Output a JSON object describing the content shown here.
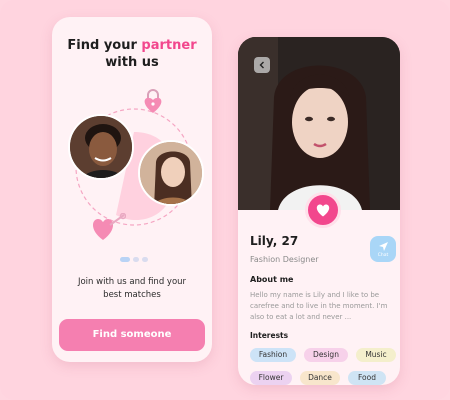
{
  "onboarding": {
    "title_line1_prefix": "Find your ",
    "title_accent": "partner",
    "title_line2": "with us",
    "subtitle": "Join with us and find your best matches",
    "cta_label": "Find someone"
  },
  "profile": {
    "name": "Lily, 27",
    "job": "Fashion Designer",
    "chat_label": "Chat",
    "about_title": "About me",
    "about_text": "Hello my name is Lily and I like to be carefree and to live in the moment. I'm also to eat a lot and never ...",
    "interests_title": "Interests",
    "interests": [
      {
        "label": "Fashion",
        "color": "#cde3f7"
      },
      {
        "label": "Design",
        "color": "#f7d1ea"
      },
      {
        "label": "Music",
        "color": "#f4efcc"
      },
      {
        "label": "Flower",
        "color": "#ecd2f1"
      },
      {
        "label": "Dance",
        "color": "#f8e6cc"
      },
      {
        "label": "Food",
        "color": "#cfe4f4"
      }
    ]
  },
  "colors": {
    "accent": "#f2478d",
    "cta": "#f57fb0",
    "background": "#ffd4df",
    "card": "#fff2f5"
  }
}
